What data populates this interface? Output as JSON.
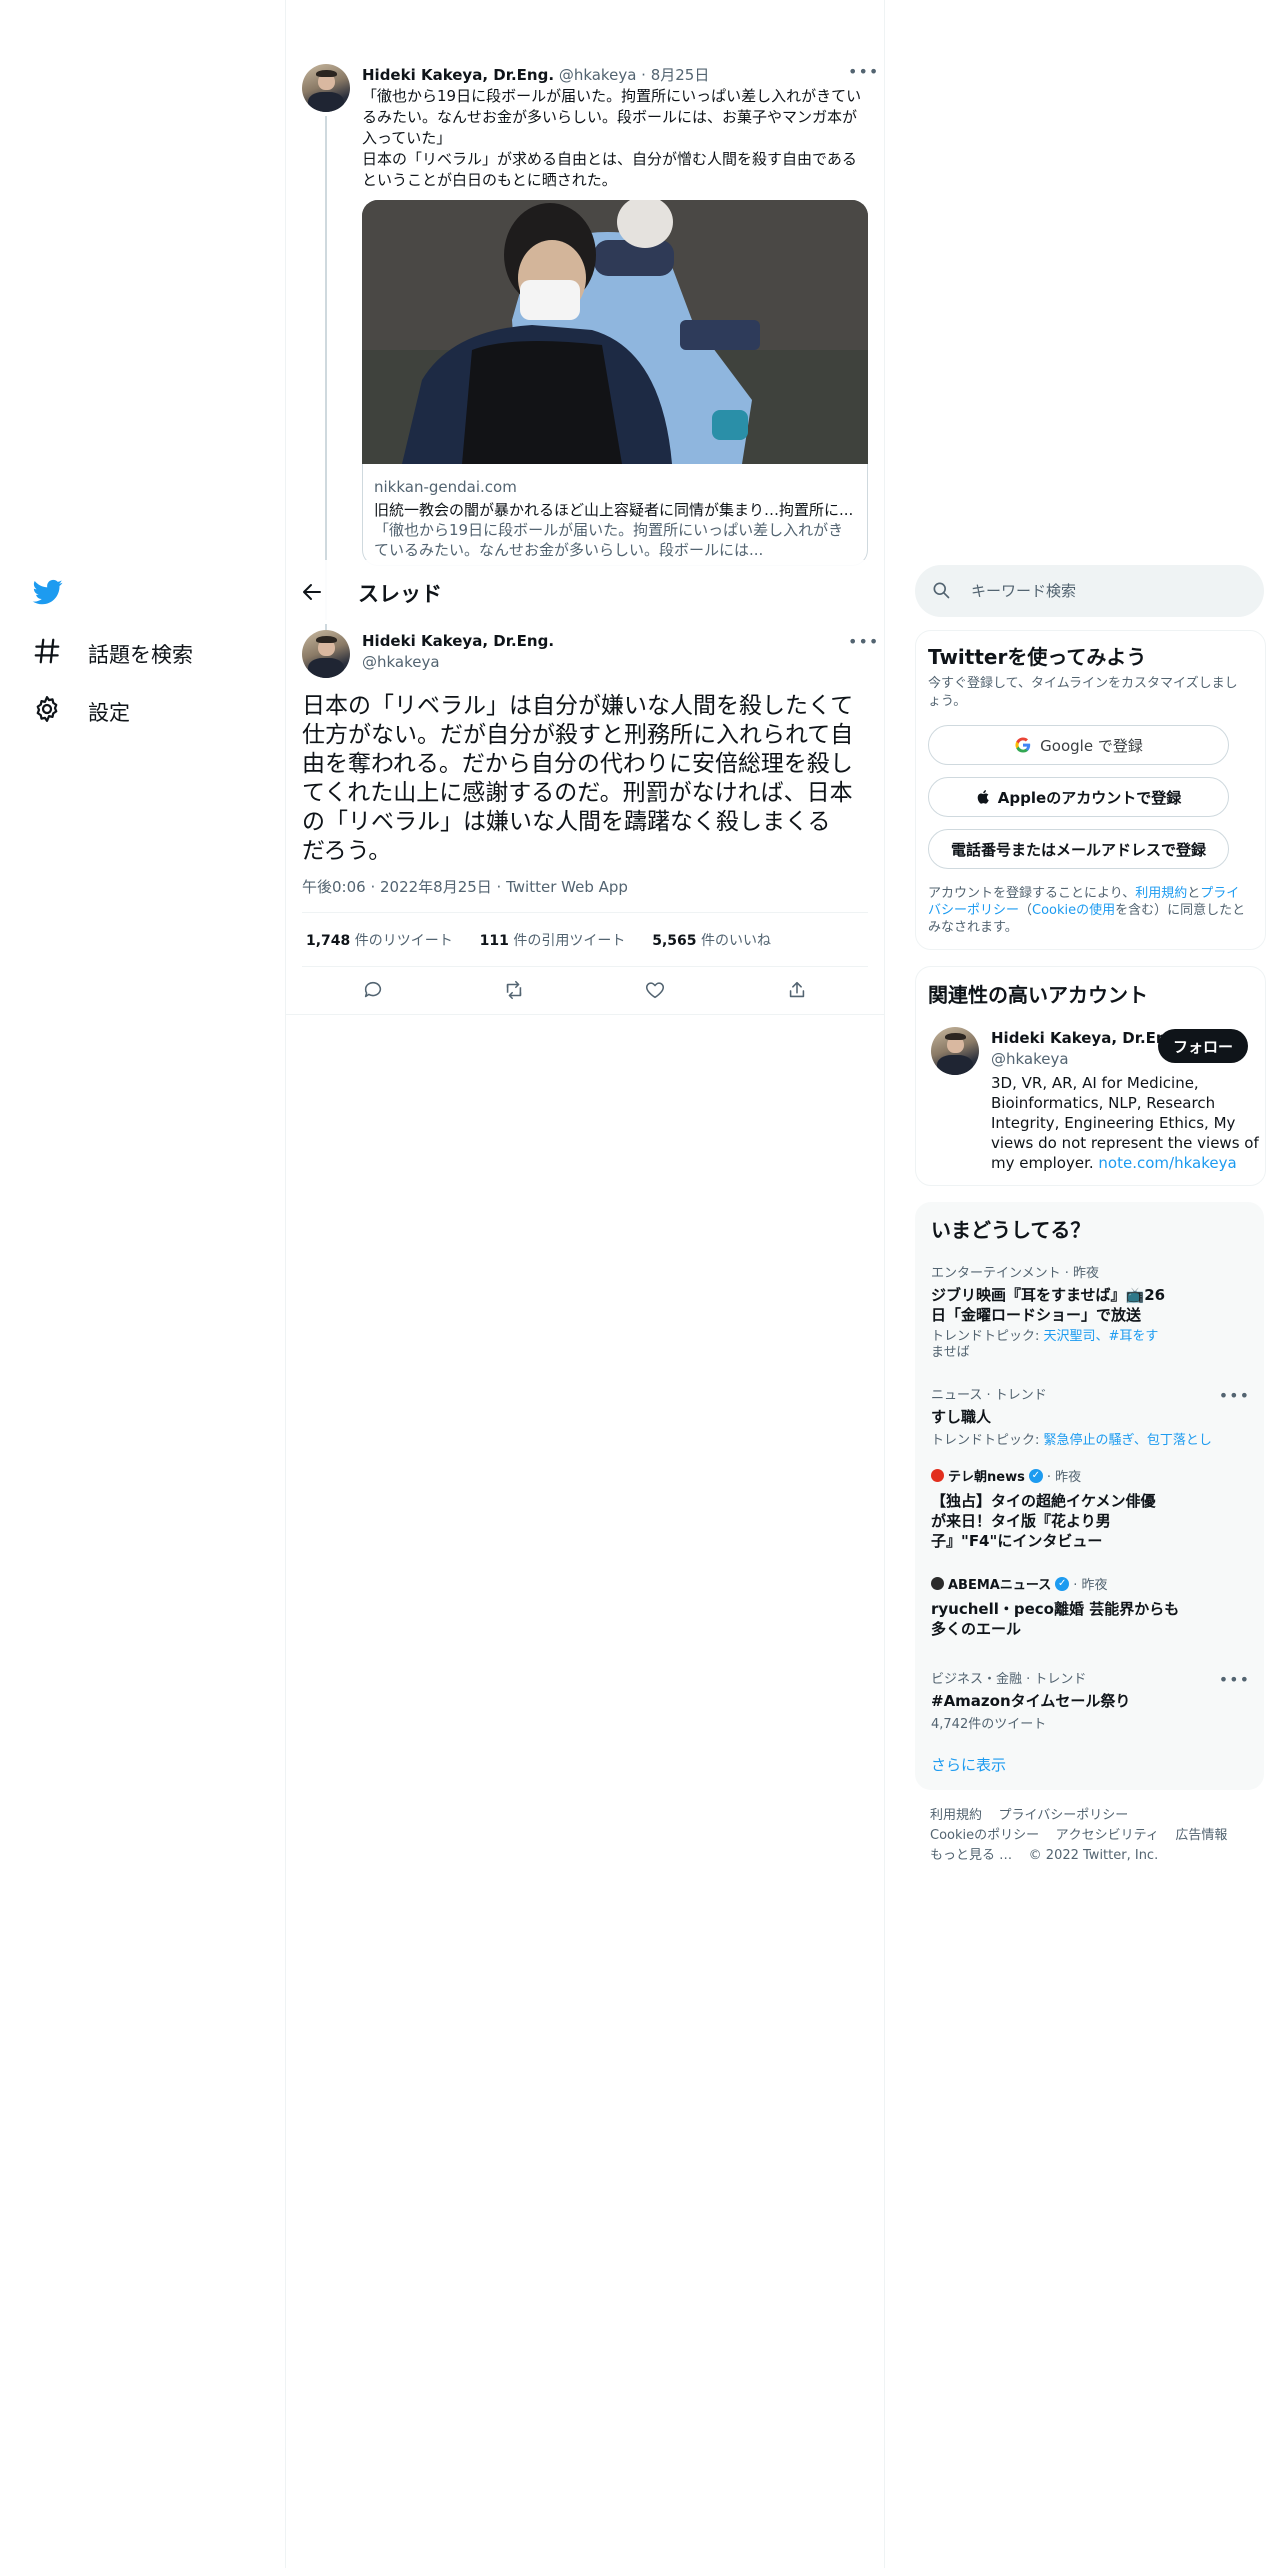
{
  "nav": {
    "items": [
      {
        "label": "話題を検索",
        "icon": "hashtag-icon"
      },
      {
        "label": "設定",
        "icon": "gear-icon"
      }
    ]
  },
  "prev_tweet": {
    "name": "Hideki Kakeya, Dr.Eng.",
    "handle": "@hkakeya",
    "date": "· 8月25日",
    "text_lines": [
      "「徹也から19日に段ボールが届いた。拘置所にいっぱい差し入れがきてい",
      "るみたい。なんせお金が多いらしい。段ボールには、お菓子やマンガ本が",
      "入っていた」",
      "日本の「リベラル」が求める自由とは、自分が憎む人間を殺す自由である",
      "ということが白日のもとに晒された。"
    ],
    "card": {
      "domain": "nikkan-gendai.com",
      "title": "旧統一教会の闇が暴かれるほど山上容疑者に同情が集まり…拘置所に...",
      "desc_lines": [
        "「徹也から19日に段ボールが届いた。拘置所にいっぱい差し入れがき",
        "ているみたい。なんせお金が多いらしい。段ボールには..."
      ]
    }
  },
  "header": {
    "title": "スレッド"
  },
  "main_tweet": {
    "name": "Hideki Kakeya, Dr.Eng.",
    "handle": "@hkakeya",
    "text_lines": [
      "日本の「リベラル」は自分が嫌いな人間を殺したくて",
      "仕方がない。だが自分が殺すと刑務所に入れられて自",
      "由を奪われる。だから自分の代わりに安倍総理を殺し",
      "てくれた山上に感謝するのだ。刑罰がなければ、日本",
      "の「リベラル」は嫌いな人間を躊躇なく殺しまくる",
      "だろう。"
    ],
    "meta": "午後0:06 · 2022年8月25日 · Twitter Web App",
    "stats": {
      "retweets_count": "1,748",
      "retweets_label": "件のリツイート",
      "quotes_count": "111",
      "quotes_label": "件の引用ツイート",
      "likes_count": "5,565",
      "likes_label": "件のいいね"
    }
  },
  "search": {
    "placeholder": "キーワード検索"
  },
  "signup": {
    "title": "Twitterを使ってみよう",
    "subtitle_lines": [
      "今すぐ登録して、タイムラインをカスタマイズしまし",
      "ょう。"
    ],
    "google": "Google で登録",
    "apple": "Appleのアカウントで登録",
    "phone": "電話番号またはメールアドレスで登録",
    "legal_1": "アカウントを登録することにより、",
    "legal_terms": "利用規約",
    "legal_and": "と",
    "legal_privacy_a": "プライ",
    "legal_privacy_b": "バシーポリシー",
    "legal_paren_open": "（",
    "legal_cookie": "Cookieの使用",
    "legal_2": "を含む）に同意したと",
    "legal_3": "みなされます。"
  },
  "related": {
    "title": "関連性の高いアカウント",
    "name": "Hideki Kakeya, Dr.Eng.",
    "handle": "@hkakeya",
    "follow": "フォロー",
    "bio_lines": [
      "3D, VR, AR, AI for Medicine,",
      "Bioinformatics, NLP, Research",
      "Integrity, Engineering Ethics, My",
      "views do not represent the views of"
    ],
    "bio_last": "my employer.",
    "bio_link": "note.com/hkakeya"
  },
  "trends": {
    "title": "いまどうしてる？",
    "t1_meta": "エンターテインメント · 昨夜",
    "t1_title_a": "ジブリ映画『耳をすませば』📺26",
    "t1_title_b": "日「金曜ロードショー」で放送",
    "t1_topic_label": "トレンドトピック: ",
    "t1_topic_a": "天沢聖司、#耳をす",
    "t1_topic_b": "ませば",
    "t2_meta": "ニュース · トレンド",
    "t2_title": "すし職人",
    "t2_topic_label": "トレンドトピック: ",
    "t2_topic": "緊急停止の騒ぎ、包丁落とし",
    "t3_source": "テレ朝news",
    "t3_time": "· 昨夜",
    "t3_title_lines": [
      "【独占】タイの超絶イケメン俳優",
      "が来日！タイ版『花より男",
      "子』\"F4\"にインタビュー"
    ],
    "t4_source": "ABEMAニュース",
    "t4_time": "· 昨夜",
    "t4_title_lines": [
      "ryuchell・peco離婚 芸能界からも",
      "多くのエール"
    ],
    "t5_meta": "ビジネス・金融 · トレンド",
    "t5_title": "#Amazonタイムセール祭り",
    "t5_count": "4,742件のツイート",
    "show_more": "さらに表示"
  },
  "footer": {
    "terms": "利用規約",
    "privacy": "プライバシーポリシー",
    "cookie": "Cookieのポリシー",
    "accessibility": "アクセシビリティ",
    "ads": "広告情報",
    "more": "もっと見る …",
    "copyright": "© 2022 Twitter, Inc."
  },
  "colors": {
    "accent": "#1d9bf0",
    "text": "#0f1419",
    "muted": "#536471",
    "border": "#eff3f4"
  }
}
